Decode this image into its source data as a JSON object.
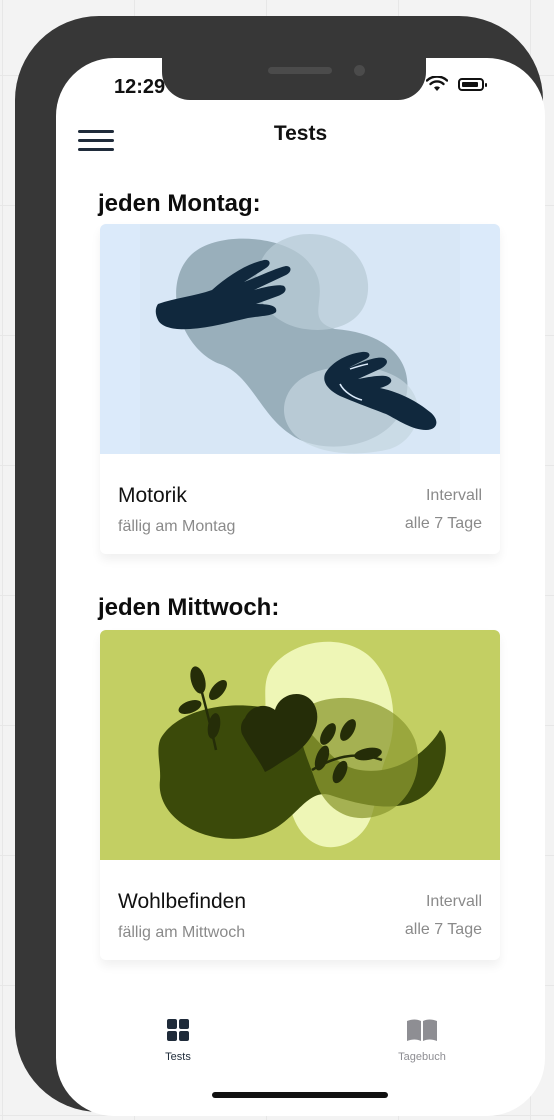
{
  "status_bar": {
    "time": "12:29"
  },
  "nav": {
    "title": "Tests",
    "menu_icon": "hamburger-menu-icon"
  },
  "sections": [
    {
      "heading": "jeden Montag:",
      "card": {
        "name": "Motorik",
        "due": "fällig am Montag",
        "interval_label": "Intervall",
        "interval_value": "alle 7 Tage",
        "image_bg": "#dbeafa",
        "illustration": "hands-illustration"
      }
    },
    {
      "heading": "jeden Mittwoch:",
      "card": {
        "name": "Wohlbefinden",
        "due": "fällig am Mittwoch",
        "interval_label": "Intervall",
        "interval_value": "alle 7 Tage",
        "image_bg": "#c3cf63",
        "illustration": "heart-leaves-illustration"
      }
    }
  ],
  "tabbar": {
    "tabs": [
      {
        "label": "Tests",
        "icon": "grid-icon",
        "active": true
      },
      {
        "label": "Tagebuch",
        "icon": "book-icon",
        "active": false
      }
    ],
    "active_color": "#1f2b3a",
    "inactive_color": "#8e8e93"
  }
}
